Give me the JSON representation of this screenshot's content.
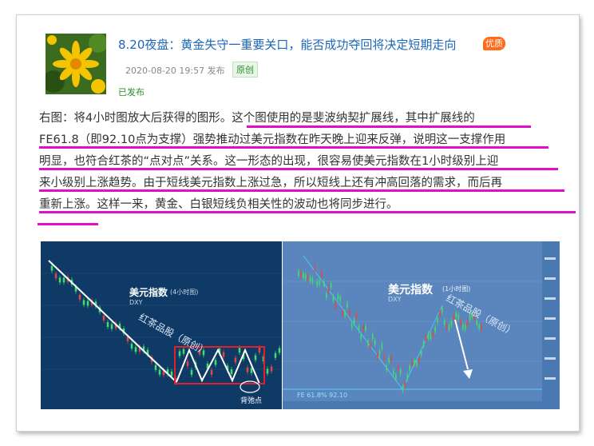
{
  "post": {
    "title": "8.20夜盘：黄金失守一重要关口，能否成功夺回将决定短期走向",
    "badge": "优质",
    "date": "2020-08-20 19:57 发布",
    "original_tag": "原创",
    "status": "已发布"
  },
  "paragraph": {
    "lines": [
      "右图：将4小时图放大后获得的图形。这个图使用的是斐波纳契扩展线，其中扩展线的",
      "FE61.8（即92.10点为支撑）强势推动过美元指数在昨天晚上迎来反弹，说明这一支撑作用",
      "明显，也符合红茶的“点对点”关系。这一形态的出现，很容易使美元指数在1小时级别上迎",
      "来小级别上涨趋势。由于短线美元指数上涨过急，所以短线上还有冲高回落的需求，而后再",
      "重新上涨。这样一来，黄金、白银短线负相关性的波动也将同步进行。"
    ]
  },
  "left_chart": {
    "title": "美元指数",
    "title_sub": "(4小时图)",
    "ticker": "DXY",
    "watermark": "红茶品股（原创）",
    "note": "背弛点",
    "accent": "#e0202a"
  },
  "right_chart": {
    "title": "美元指数",
    "title_sub": "(1小时图)",
    "ticker": "DXY",
    "watermark": "红茶品股（原创）",
    "fib_label": "FE 61.8% 92.10"
  },
  "colors": {
    "underline": "#e010c8",
    "link": "#1a66b8",
    "green": "#2d8c2d"
  }
}
